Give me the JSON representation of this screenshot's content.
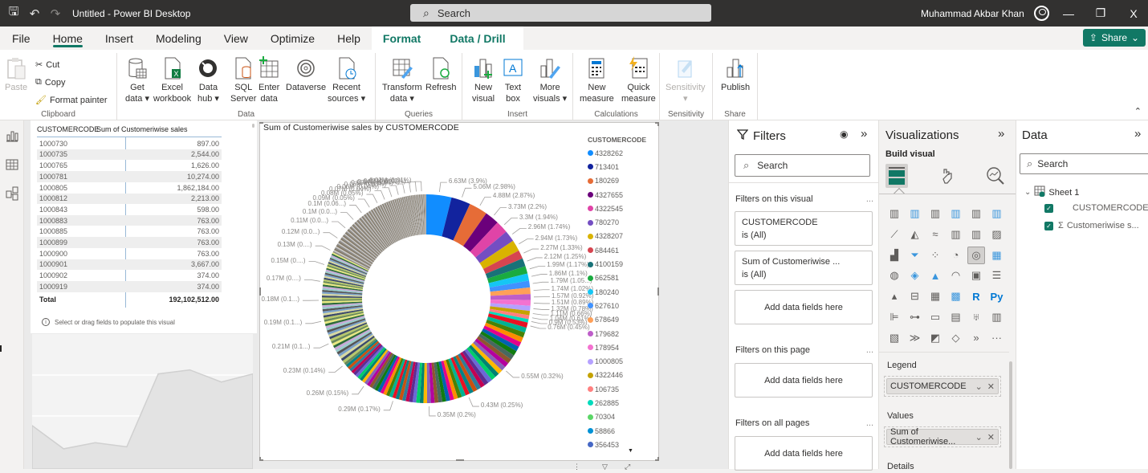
{
  "titlebar": {
    "title": "Untitled - Power BI Desktop",
    "search_placeholder": "Search",
    "user": "Muhammad Akbar Khan",
    "minimize": "—",
    "restore": "❐",
    "close": "X"
  },
  "menu": {
    "items": [
      "File",
      "Home",
      "Insert",
      "Modeling",
      "View",
      "Optimize",
      "Help"
    ],
    "active": "Home",
    "contextual": [
      "Format",
      "Data / Drill"
    ],
    "share": "Share"
  },
  "ribbon": {
    "clipboard": {
      "paste": "Paste",
      "cut": "Cut",
      "copy": "Copy",
      "format_painter": "Format painter",
      "label": "Clipboard"
    },
    "data": {
      "label": "Data",
      "buttons": [
        {
          "l1": "Get",
          "l2": "data ▾"
        },
        {
          "l1": "Excel",
          "l2": "workbook"
        },
        {
          "l1": "Data",
          "l2": "hub ▾"
        },
        {
          "l1": "SQL",
          "l2": "Server"
        },
        {
          "l1": "Enter",
          "l2": "data"
        },
        {
          "l1": "Dataverse",
          "l2": ""
        },
        {
          "l1": "Recent",
          "l2": "sources ▾"
        }
      ]
    },
    "queries": {
      "label": "Queries",
      "buttons": [
        {
          "l1": "Transform",
          "l2": "data ▾"
        },
        {
          "l1": "Refresh",
          "l2": ""
        }
      ]
    },
    "insert": {
      "label": "Insert",
      "buttons": [
        {
          "l1": "New",
          "l2": "visual"
        },
        {
          "l1": "Text",
          "l2": "box"
        },
        {
          "l1": "More",
          "l2": "visuals ▾"
        }
      ]
    },
    "calculations": {
      "label": "Calculations",
      "buttons": [
        {
          "l1": "New",
          "l2": "measure"
        },
        {
          "l1": "Quick",
          "l2": "measure"
        }
      ]
    },
    "sensitivity": {
      "label": "Sensitivity",
      "buttons": [
        {
          "l1": "Sensitivity",
          "l2": "▾"
        }
      ]
    },
    "share": {
      "label": "Share",
      "buttons": [
        {
          "l1": "Publish",
          "l2": ""
        }
      ]
    }
  },
  "table_visual": {
    "headers": [
      "CUSTOMERCODE",
      "Sum of Customeriwise sales"
    ],
    "rows": [
      [
        "1000730",
        "897.00"
      ],
      [
        "1000735",
        "2,544.00"
      ],
      [
        "1000765",
        "1,626.00"
      ],
      [
        "1000781",
        "10,274.00"
      ],
      [
        "1000805",
        "1,862,184.00"
      ],
      [
        "1000812",
        "2,213.00"
      ],
      [
        "1000843",
        "598.00"
      ],
      [
        "1000883",
        "763.00"
      ],
      [
        "1000885",
        "763.00"
      ],
      [
        "1000899",
        "763.00"
      ],
      [
        "1000900",
        "763.00"
      ],
      [
        "1000901",
        "3,667.00"
      ],
      [
        "1000902",
        "374.00"
      ],
      [
        "1000919",
        "374.00"
      ]
    ],
    "total_label": "Total",
    "total_value": "192,102,512.00",
    "info": "Select or drag fields to populate this visual"
  },
  "chart_data": {
    "type": "pie",
    "variant": "donut",
    "title": "Sum of Customeriwise sales by CUSTOMERCODE",
    "legend_title": "CUSTOMERCODE",
    "legend_position": "right",
    "legend": [
      {
        "name": "4328262",
        "color": "#118dff"
      },
      {
        "name": "713401",
        "color": "#12239e"
      },
      {
        "name": "180269",
        "color": "#e66c37"
      },
      {
        "name": "4327655",
        "color": "#6b007b"
      },
      {
        "name": "4322545",
        "color": "#e044a7"
      },
      {
        "name": "780270",
        "color": "#744ec2"
      },
      {
        "name": "4328207",
        "color": "#d9b300"
      },
      {
        "name": "684461",
        "color": "#d64550"
      },
      {
        "name": "4100159",
        "color": "#197278"
      },
      {
        "name": "662581",
        "color": "#1aab40"
      },
      {
        "name": "180240",
        "color": "#15c6f4"
      },
      {
        "name": "627610",
        "color": "#4092ff"
      },
      {
        "name": "678649",
        "color": "#ffa058"
      },
      {
        "name": "179682",
        "color": "#be5dc9"
      },
      {
        "name": "178954",
        "color": "#f472d0"
      },
      {
        "name": "1000805",
        "color": "#b5a1ff"
      },
      {
        "name": "4322446",
        "color": "#c4a200"
      },
      {
        "name": "106735",
        "color": "#ff8080"
      },
      {
        "name": "262885",
        "color": "#00dbbc"
      },
      {
        "name": "70304",
        "color": "#5bd667"
      },
      {
        "name": "58866",
        "color": "#0091d5"
      },
      {
        "name": "356453",
        "color": "#4668c5"
      }
    ],
    "labeled_slices": [
      {
        "label": "6.63M (3.9%)",
        "value": 6.63,
        "pct": 3.9
      },
      {
        "label": "5.06M (2.98%)",
        "value": 5.06,
        "pct": 2.98
      },
      {
        "label": "4.88M (2.87%)",
        "value": 4.88,
        "pct": 2.87
      },
      {
        "label": "3.73M (2.2%)",
        "value": 3.73,
        "pct": 2.2
      },
      {
        "label": "3.3M (1.94%)",
        "value": 3.3,
        "pct": 1.94
      },
      {
        "label": "2.96M (1.74%)",
        "value": 2.96,
        "pct": 1.74
      },
      {
        "label": "2.94M (1.73%)",
        "value": 2.94,
        "pct": 1.73
      },
      {
        "label": "2.27M (1.33%)",
        "value": 2.27,
        "pct": 1.33
      },
      {
        "label": "2.12M (1.25%)",
        "value": 2.12,
        "pct": 1.25
      },
      {
        "label": "1.99M (1.17%)",
        "value": 1.99,
        "pct": 1.17
      },
      {
        "label": "1.86M (1.1%)",
        "value": 1.86,
        "pct": 1.1
      },
      {
        "label": "1.79M (1.05...)",
        "value": 1.79,
        "pct": 1.05
      },
      {
        "label": "1.74M (1.02%)",
        "value": 1.74,
        "pct": 1.02
      },
      {
        "label": "1.57M (0.92%)",
        "value": 1.57,
        "pct": 0.92
      },
      {
        "label": "1.51M (0.89%)",
        "value": 1.51,
        "pct": 0.89
      },
      {
        "label": "1.32M (0.78%)",
        "value": 1.32,
        "pct": 0.78
      },
      {
        "label": "1.11M (0.66%)",
        "value": 1.11,
        "pct": 0.66
      },
      {
        "label": "1.04M (0.61%)",
        "value": 1.04,
        "pct": 0.61
      },
      {
        "label": "0.9M (0.53%)",
        "value": 0.9,
        "pct": 0.53
      },
      {
        "label": "0.76M (0.45%)",
        "value": 0.76,
        "pct": 0.45
      },
      {
        "label": "0.55M (0.32%)",
        "value": 0.55,
        "pct": 0.32
      },
      {
        "label": "0.43M (0.25%)",
        "value": 0.43,
        "pct": 0.25
      },
      {
        "label": "0.35M (0.2%)",
        "value": 0.35,
        "pct": 0.2
      },
      {
        "label": "0.29M (0.17%)",
        "value": 0.29,
        "pct": 0.17
      },
      {
        "label": "0.26M (0.15%)",
        "value": 0.26,
        "pct": 0.15
      },
      {
        "label": "0.23M (0.14%)",
        "value": 0.23,
        "pct": 0.14
      },
      {
        "label": "0.21M (0.1...)",
        "value": 0.21,
        "pct": 0.12
      },
      {
        "label": "0.19M (0.1...)",
        "value": 0.19,
        "pct": 0.11
      },
      {
        "label": "0.18M (0.1...)",
        "value": 0.18,
        "pct": 0.1
      },
      {
        "label": "0.17M (0....)",
        "value": 0.17,
        "pct": 0.09
      },
      {
        "label": "0.15M (0....)",
        "value": 0.15,
        "pct": 0.09
      },
      {
        "label": "0.13M (0....)",
        "value": 0.13,
        "pct": 0.08
      },
      {
        "label": "0.12M (0.0...)",
        "value": 0.12,
        "pct": 0.07
      },
      {
        "label": "0.11M (0.0...)",
        "value": 0.11,
        "pct": 0.06
      },
      {
        "label": "0.1M (0.0...)",
        "value": 0.1,
        "pct": 0.06
      },
      {
        "label": "0.1M (0.06...)",
        "value": 0.1,
        "pct": 0.06
      },
      {
        "label": "0.09M (0.05%)",
        "value": 0.09,
        "pct": 0.05
      },
      {
        "label": "0.08M (0.05%)",
        "value": 0.08,
        "pct": 0.05
      },
      {
        "label": "0.07M (0.04%)",
        "value": 0.07,
        "pct": 0.04
      },
      {
        "label": "0.06M (0.04%)",
        "value": 0.06,
        "pct": 0.04
      },
      {
        "label": "0.06M (0.03%)",
        "value": 0.06,
        "pct": 0.03
      },
      {
        "label": "0.05M (0.03%)",
        "value": 0.05,
        "pct": 0.03
      },
      {
        "label": "0.04M (0.02%)",
        "value": 0.04,
        "pct": 0.02
      },
      {
        "label": "0.03M (0.02%)",
        "value": 0.03,
        "pct": 0.02
      },
      {
        "label": "0.02M (0.01%)",
        "value": 0.02,
        "pct": 0.01
      }
    ],
    "other_slices_note": "many small unlabeled slices"
  },
  "filters": {
    "title": "Filters",
    "search_placeholder": "Search",
    "on_visual": "Filters on this visual",
    "on_page": "Filters on this page",
    "on_all": "Filters on all pages",
    "more": "...",
    "cards": [
      {
        "field": "CUSTOMERCODE",
        "state": "is (All)"
      },
      {
        "field": "Sum of Customeriwise ...",
        "state": "is (All)"
      }
    ],
    "add_fields": "Add data fields here"
  },
  "visualizations": {
    "title": "Visualizations",
    "build_visual": "Build visual",
    "legend_label": "Legend",
    "legend_field": "CUSTOMERCODE",
    "values_label": "Values",
    "values_field": "Sum of Customeriwise...",
    "details_label": "Details"
  },
  "data_pane": {
    "title": "Data",
    "search_placeholder": "Search",
    "table": "Sheet 1",
    "fields": [
      "CUSTOMERCODE",
      "Customeriwise s..."
    ]
  },
  "area_visual": {
    "values": [
      0.35,
      0.12,
      0.18,
      0.14,
      0.86,
      0.9,
      0.78,
      0.86
    ]
  }
}
